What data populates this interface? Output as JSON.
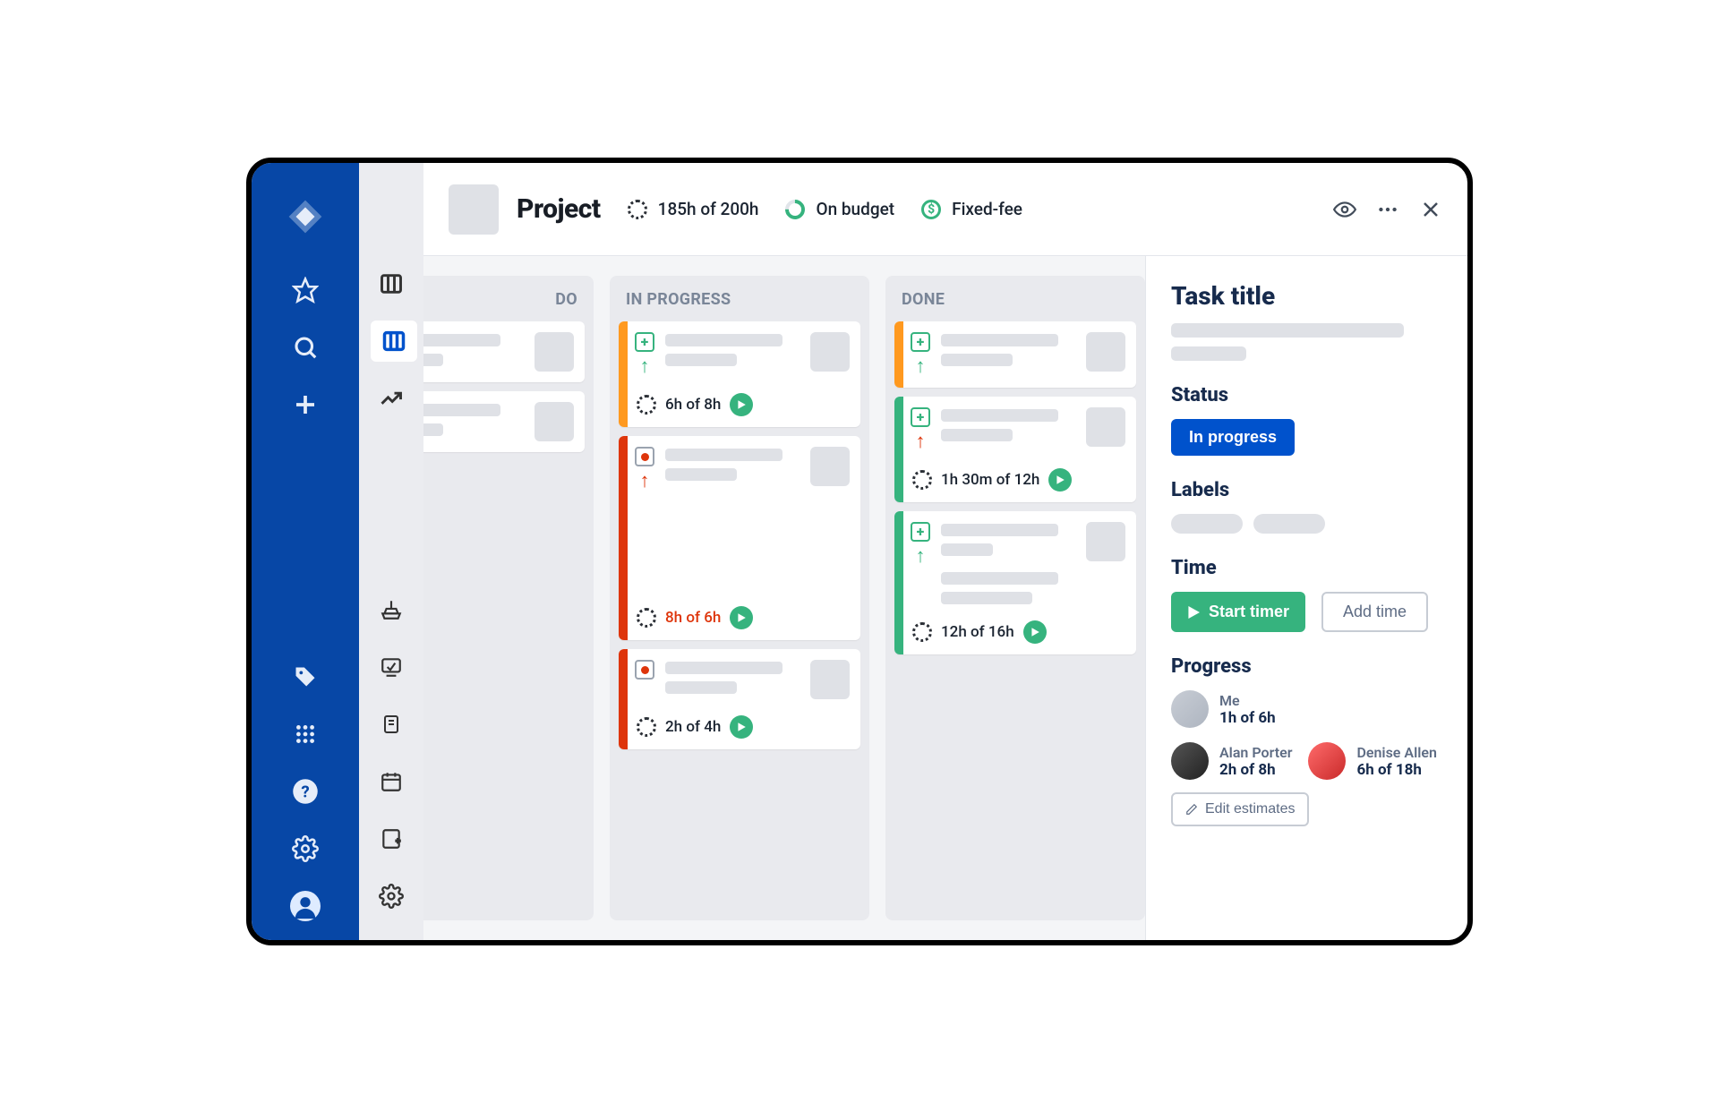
{
  "header": {
    "title": "Project",
    "hours": "185h of 200h",
    "budget_label": "On budget",
    "fee_label": "Fixed-fee"
  },
  "board": {
    "columns": [
      {
        "id": "todo",
        "title": "DO"
      },
      {
        "id": "inprogress",
        "title": "IN PROGRESS"
      },
      {
        "id": "done",
        "title": "DONE"
      }
    ],
    "cards": {
      "inprogress": [
        {
          "stripe": "orange",
          "badge": "plus",
          "arrow": "green",
          "time": "6h of 8h",
          "over": false
        },
        {
          "stripe": "red",
          "badge": "dot",
          "arrow": "red",
          "time": "8h of 6h",
          "over": true,
          "tall": true
        },
        {
          "stripe": "red",
          "badge": "dot",
          "arrow": "",
          "time": "2h of 4h",
          "over": false
        }
      ],
      "done": [
        {
          "stripe": "orange",
          "badge": "plus",
          "arrow": "green",
          "time": "",
          "over": false,
          "nofoot": true
        },
        {
          "stripe": "green",
          "badge": "plus",
          "arrow": "red",
          "time": "1h 30m of 12h",
          "over": false
        },
        {
          "stripe": "green",
          "badge": "plus",
          "arrow": "green",
          "time": "12h of 16h",
          "over": false,
          "extralines": true
        }
      ]
    }
  },
  "details": {
    "title": "Task title",
    "status_label": "Status",
    "status_value": "In progress",
    "labels_label": "Labels",
    "time_label": "Time",
    "start_timer": "Start timer",
    "add_time": "Add time",
    "progress_label": "Progress",
    "people": {
      "me": {
        "name": "Me",
        "time": "1h of 6h"
      },
      "alan": {
        "name": "Alan Porter",
        "time": "2h of 8h"
      },
      "denise": {
        "name": "Denise Allen",
        "time": "6h of 18h"
      }
    },
    "edit_estimates": "Edit estimates"
  }
}
